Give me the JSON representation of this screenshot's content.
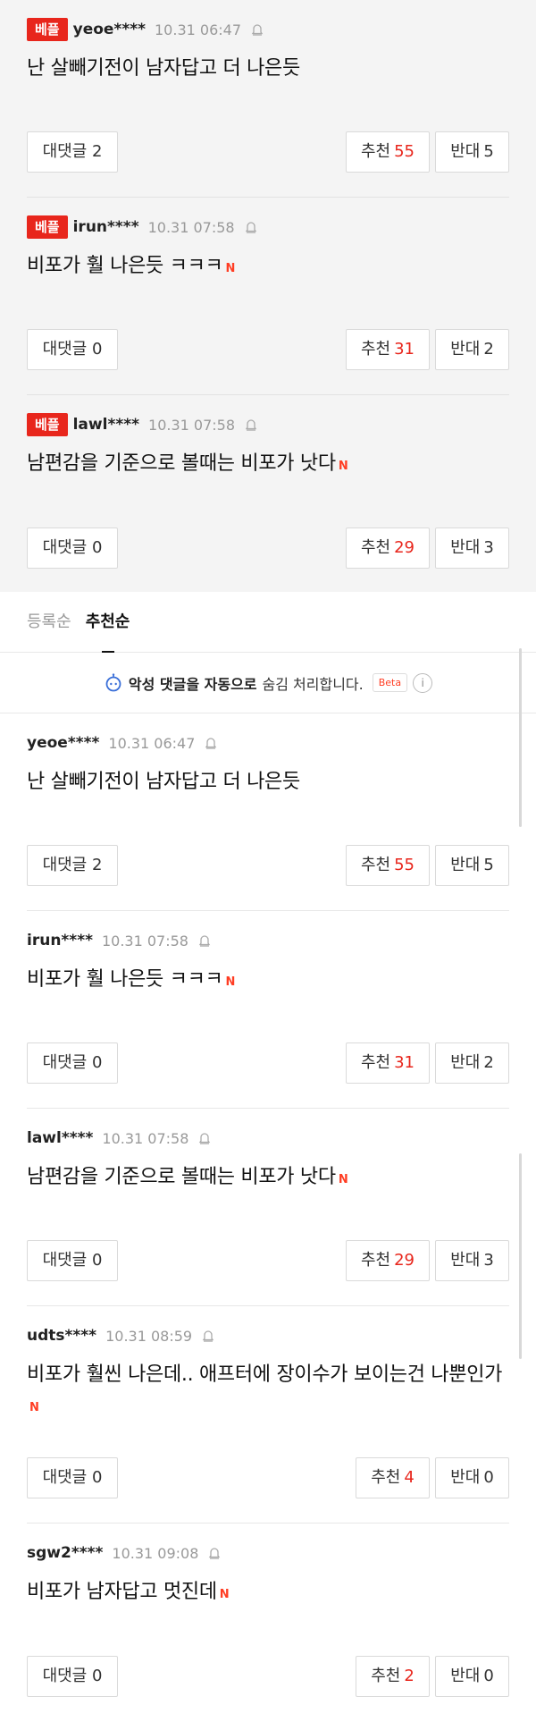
{
  "best": [
    {
      "badge": "베플",
      "nick": "yeoe****",
      "date": "10.31 06:47",
      "text": "난 살빼기전이 남자답고 더 나은듯",
      "new": false,
      "reply_label": "대댓글",
      "reply_count": "2",
      "like_label": "추천",
      "like_count": "55",
      "dislike_label": "반대",
      "dislike_count": "5"
    },
    {
      "badge": "베플",
      "nick": "irun****",
      "date": "10.31 07:58",
      "text": "비포가 훨 나은듯 ㅋㅋㅋ",
      "new": true,
      "reply_label": "대댓글",
      "reply_count": "0",
      "like_label": "추천",
      "like_count": "31",
      "dislike_label": "반대",
      "dislike_count": "2"
    },
    {
      "badge": "베플",
      "nick": "lawl****",
      "date": "10.31 07:58",
      "text": "남편감을 기준으로 볼때는 비포가 낫다",
      "new": true,
      "reply_label": "대댓글",
      "reply_count": "0",
      "like_label": "추천",
      "like_count": "29",
      "dislike_label": "반대",
      "dislike_count": "3"
    }
  ],
  "sort": {
    "registered": "등록순",
    "recommended": "추천순"
  },
  "notice": {
    "strong": "악성 댓글을 자동으로",
    "text": "숨김 처리합니다.",
    "beta": "Beta",
    "info": "i"
  },
  "new_mark": "N",
  "comments": [
    {
      "nick": "yeoe****",
      "date": "10.31 06:47",
      "text": "난 살빼기전이 남자답고 더 나은듯",
      "reply_label": "대댓글",
      "reply_count": "2",
      "like_label": "추천",
      "like_count": "55",
      "dislike_label": "반대",
      "dislike_count": "5"
    },
    {
      "nick": "irun****",
      "date": "10.31 07:58",
      "text": "비포가 훨 나은듯 ㅋㅋㅋ",
      "reply_label": "대댓글",
      "reply_count": "0",
      "like_label": "추천",
      "like_count": "31",
      "dislike_label": "반대",
      "dislike_count": "2"
    },
    {
      "nick": "lawl****",
      "date": "10.31 07:58",
      "text": "남편감을 기준으로 볼때는 비포가 낫다",
      "reply_label": "대댓글",
      "reply_count": "0",
      "like_label": "추천",
      "like_count": "29",
      "dislike_label": "반대",
      "dislike_count": "3"
    },
    {
      "nick": "udts****",
      "date": "10.31 08:59",
      "text": "비포가 훨씬 나은데.. 애프터에 장이수가 보이는건 나뿐인가",
      "reply_label": "대댓글",
      "reply_count": "0",
      "like_label": "추천",
      "like_count": "4",
      "dislike_label": "반대",
      "dislike_count": "0"
    },
    {
      "nick": "sgw2****",
      "date": "10.31 09:08",
      "text": "비포가 남자답고 멋진데",
      "reply_label": "대댓글",
      "reply_count": "0",
      "like_label": "추천",
      "like_count": "2",
      "dislike_label": "반대",
      "dislike_count": "0"
    }
  ],
  "colors": {
    "accent": "#e8261c",
    "new_badge": "#ff3d23",
    "best_bg": "#f4f4f4"
  }
}
